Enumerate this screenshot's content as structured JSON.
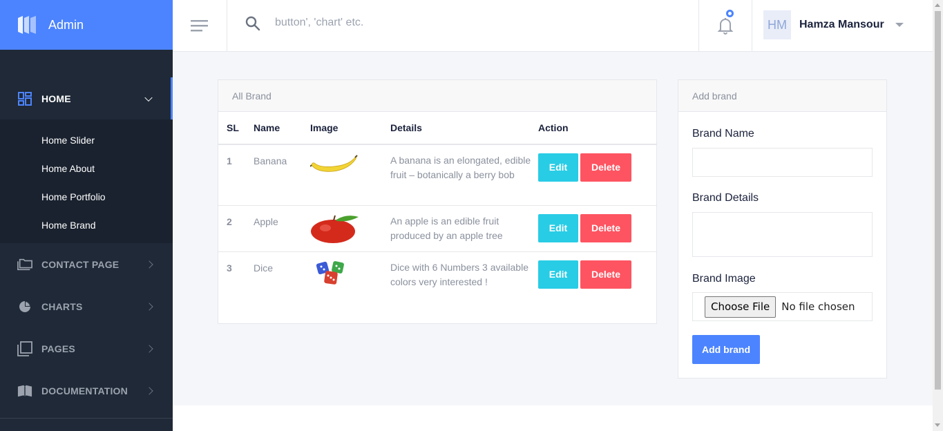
{
  "sidebar": {
    "brand_name": "Admin",
    "menu": [
      {
        "label": "HOME",
        "icon": "dashboard-icon"
      },
      {
        "label": "CONTACT PAGE",
        "icon": "folder-icon"
      },
      {
        "label": "CHARTS",
        "icon": "pie-chart-icon"
      },
      {
        "label": "PAGES",
        "icon": "pages-icon"
      },
      {
        "label": "DOCUMENTATION",
        "icon": "book-icon"
      }
    ],
    "home_submenu": [
      "Home Slider",
      "Home About",
      "Home Portfolio",
      "Home Brand"
    ]
  },
  "header": {
    "search_placeholder": "button', 'chart' etc.",
    "user_initials": "HM",
    "user_name": "Hamza Mansour"
  },
  "brand_table": {
    "title": "All Brand",
    "columns": [
      "SL",
      "Name",
      "Image",
      "Details",
      "Action"
    ],
    "rows": [
      {
        "sl": "1",
        "name": "Banana",
        "image": "banana",
        "details": "A banana is an elongated, edible fruit – botanically a berry bob"
      },
      {
        "sl": "2",
        "name": "Apple",
        "image": "apple",
        "details": "An apple is an edible fruit produced by an apple tree"
      },
      {
        "sl": "3",
        "name": "Dice",
        "image": "dice",
        "details": "Dice with 6 Numbers 3 available colors very interested !"
      }
    ],
    "edit_label": "Edit",
    "delete_label": "Delete"
  },
  "add_brand": {
    "title": "Add brand",
    "name_label": "Brand Name",
    "details_label": "Brand Details",
    "image_label": "Brand Image",
    "choose_file_label": "Choose File",
    "no_file_text": "No file chosen",
    "submit_label": "Add brand"
  },
  "colors": {
    "primary": "#4c84ff",
    "sidebar_bg": "#1f2937",
    "edit": "#29cce5",
    "delete": "#fe5461"
  }
}
